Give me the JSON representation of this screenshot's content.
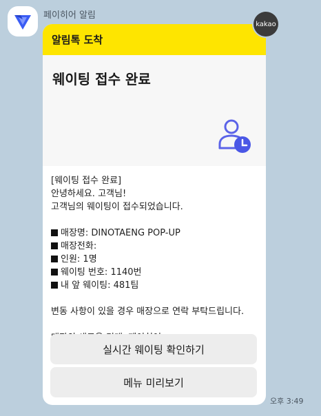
{
  "sender": {
    "name": "페이히어 알림",
    "avatar_icon": "payhere-logo-icon",
    "brand_color": "#3a5cf4"
  },
  "badge": {
    "label": "kakao"
  },
  "message": {
    "header": "알림톡 도착",
    "header_color": "#fee500",
    "hero_title": "웨이팅 접수 완료",
    "hero_icon": "user-clock-icon",
    "intro_lines": [
      "[웨이팅 접수 완료]",
      "안녕하세요. 고객님!",
      "고객님의 웨이팅이 접수되었습니다."
    ],
    "details": [
      "매장명: DINOTAENG POP-UP",
      "매장전화:",
      "인원: 1명",
      "웨이팅 번호: 1140번",
      "내 앞 웨이팅: 481팀"
    ],
    "notice": "변동 사항이 있을 경우 매장으로 연락 부탁드립니다.",
    "closing": "매장의 새로운 미래, 페이히어",
    "buttons": [
      {
        "label": "실시간 웨이팅 확인하기"
      },
      {
        "label": "메뉴 미리보기"
      }
    ]
  },
  "time": "오후 3:49"
}
